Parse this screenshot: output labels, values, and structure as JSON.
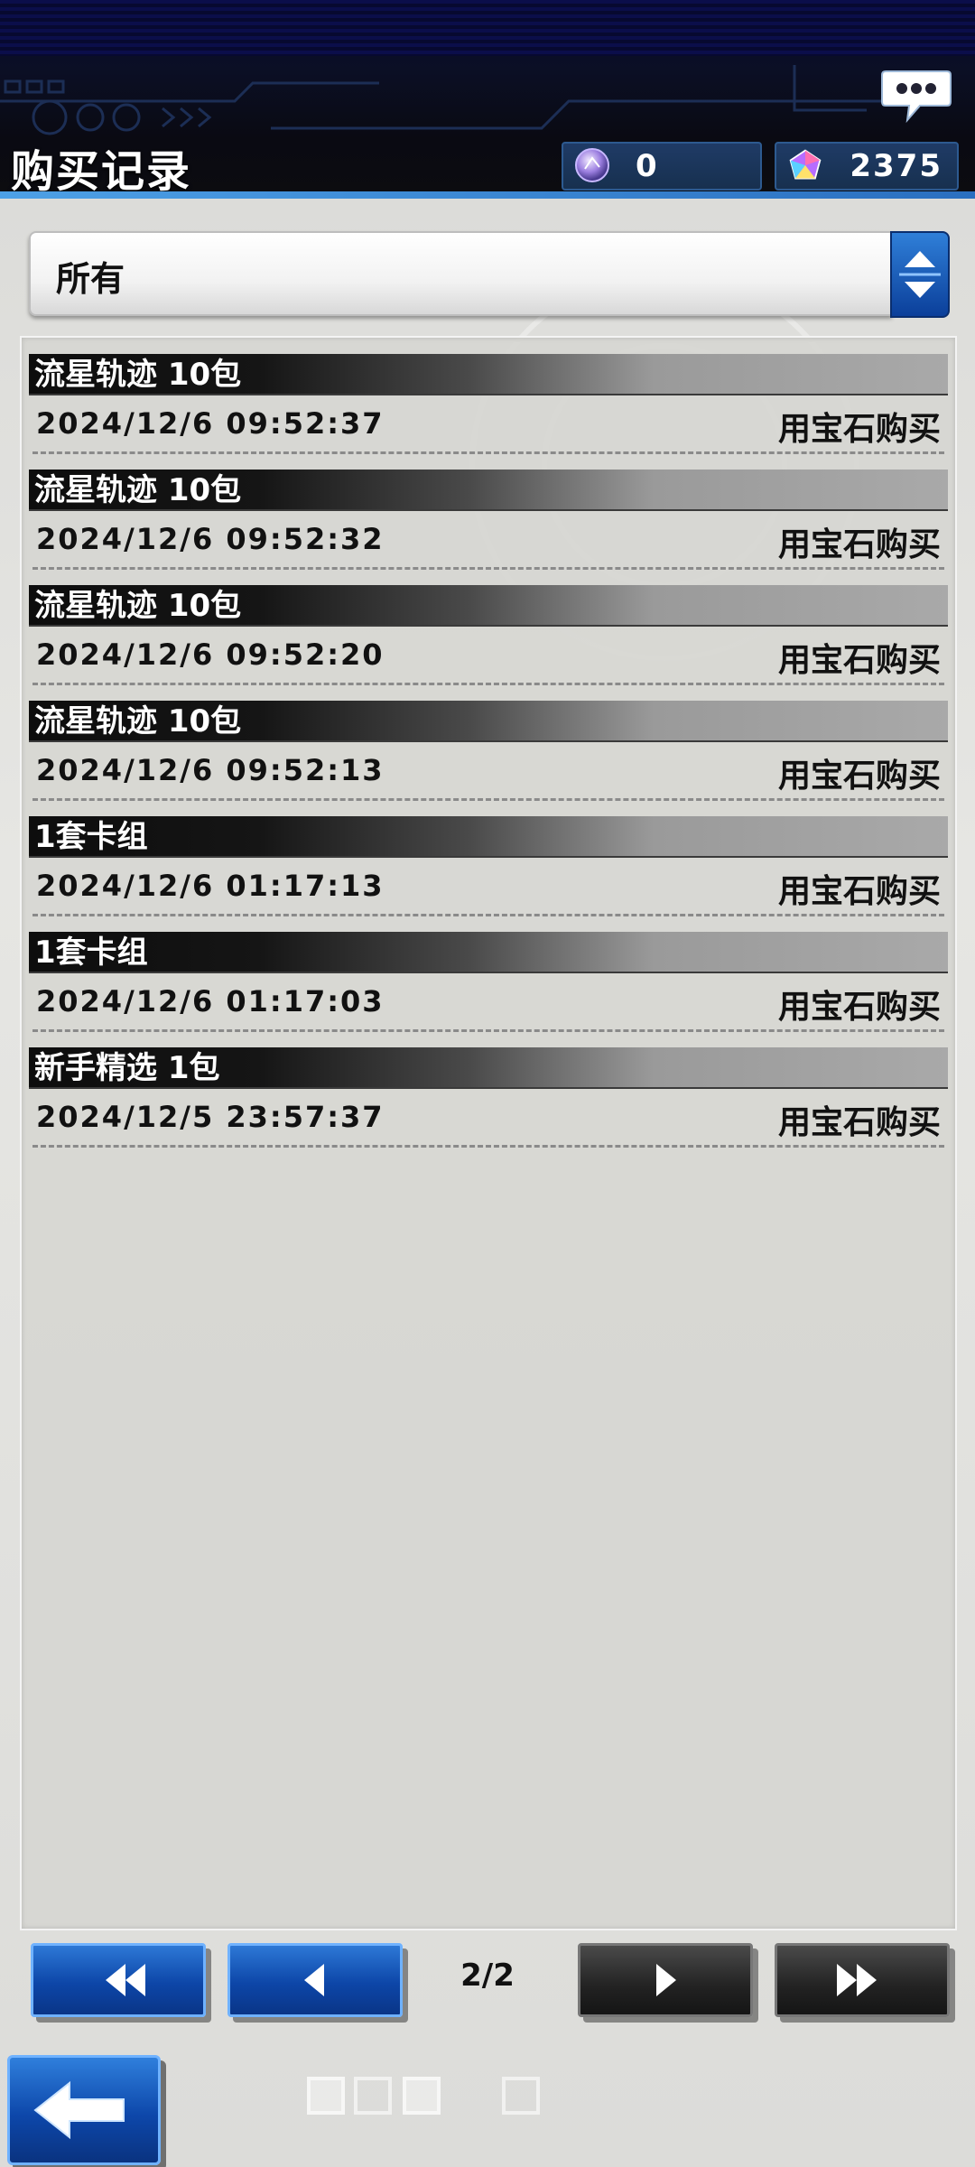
{
  "header": {
    "title": "购买记录",
    "currencies": [
      {
        "name": "orb-currency",
        "value": "0"
      },
      {
        "name": "gem-currency",
        "value": "2375"
      }
    ]
  },
  "filter": {
    "selected": "所有"
  },
  "records": [
    {
      "name": "流星轨迹 10包",
      "datetime": "2024/12/6 09:52:37",
      "method": "用宝石购买"
    },
    {
      "name": "流星轨迹 10包",
      "datetime": "2024/12/6 09:52:32",
      "method": "用宝石购买"
    },
    {
      "name": "流星轨迹 10包",
      "datetime": "2024/12/6 09:52:20",
      "method": "用宝石购买"
    },
    {
      "name": "流星轨迹 10包",
      "datetime": "2024/12/6 09:52:13",
      "method": "用宝石购买"
    },
    {
      "name": "1套卡组",
      "datetime": "2024/12/6 01:17:13",
      "method": "用宝石购买"
    },
    {
      "name": "1套卡组",
      "datetime": "2024/12/6 01:17:03",
      "method": "用宝石购买"
    },
    {
      "name": "新手精选 1包",
      "datetime": "2024/12/5 23:57:37",
      "method": "用宝石购买"
    }
  ],
  "pagination": {
    "indicator": "2/2"
  },
  "icons": {
    "chat": "chat-bubble-icon",
    "back": "back-arrow-icon",
    "first": "double-left-icon",
    "prev": "left-icon",
    "next": "right-icon",
    "last": "double-right-icon"
  }
}
